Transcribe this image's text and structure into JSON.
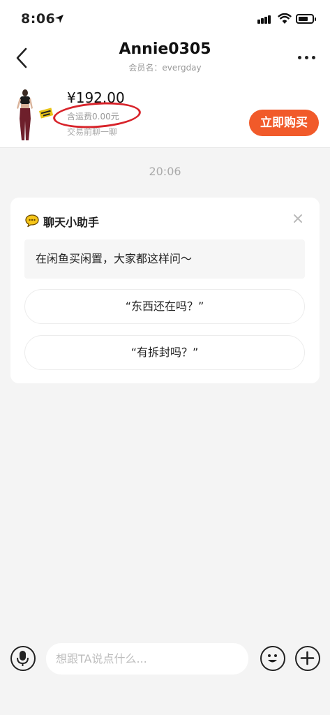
{
  "status_bar": {
    "time": "8:06"
  },
  "header": {
    "title": "Annie0305",
    "subtitle": "会员名：evergday"
  },
  "product": {
    "price": "¥192.00",
    "shipping": "含运费0.00元",
    "trade_note": "交易前聊一聊",
    "buy_label": "立即购买",
    "accent_color": "#f15a2a",
    "annotation_color": "#d8232a"
  },
  "chat": {
    "timestamp": "20:06"
  },
  "assistant_card": {
    "title": "聊天小助手",
    "prompt": "在闲鱼买闲置，大家都这样问～",
    "quick_questions": [
      "“东西还在吗？”",
      "“有拆封吗？”"
    ]
  },
  "composer": {
    "placeholder": "想跟TA说点什么..."
  },
  "icons": {
    "back": "chevron-left-icon",
    "more": "more-dots-icon",
    "assistant": "chat-bubble-icon",
    "close": "close-icon",
    "voice": "microphone-icon",
    "emoji": "emoji-icon",
    "add": "plus-icon"
  }
}
